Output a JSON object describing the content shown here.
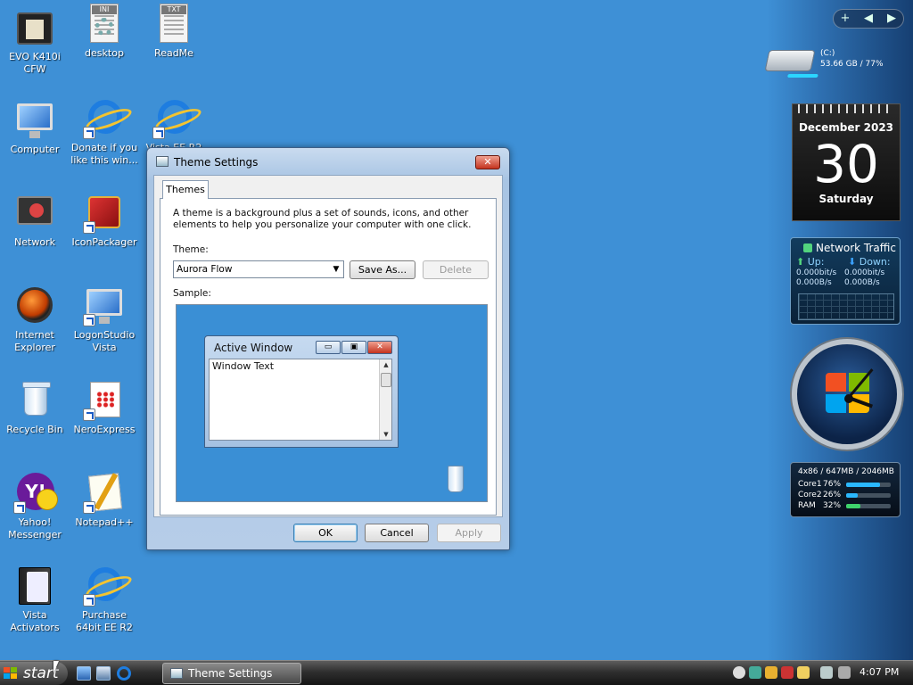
{
  "desktop_icons": [
    {
      "label": "EVO K410i CFW"
    },
    {
      "label": "desktop",
      "tag": "INI"
    },
    {
      "label": "ReadMe",
      "tag": "TXT"
    },
    {
      "label": "Computer"
    },
    {
      "label": "Donate if you like this win..."
    },
    {
      "label": "Vista EE R2"
    },
    {
      "label": "Network"
    },
    {
      "label": "IconPackager"
    },
    {
      "label": "Internet Explorer"
    },
    {
      "label": "LogonStudio Vista"
    },
    {
      "label": "Recycle Bin"
    },
    {
      "label": "NeroExpress"
    },
    {
      "label": "Yahoo! Messenger",
      "glyph_text": "Y!"
    },
    {
      "label": "Notepad++"
    },
    {
      "label": "Vista Activators"
    },
    {
      "label": "Purchase 64bit EE R2"
    }
  ],
  "sidebar": {
    "controls": [
      "+",
      "◀",
      "▶"
    ],
    "drive": {
      "name": "(C:)",
      "usage": "53.66 GB / 77%"
    },
    "calendar": {
      "month": "December 2023",
      "day": "30",
      "weekday": "Saturday"
    },
    "network_traffic": {
      "title": "Network Traffic",
      "up_label": "Up:",
      "down_label": "Down:",
      "up_bits": "0.000bit/s",
      "down_bits": "0.000bit/s",
      "up_bytes": "0.000B/s",
      "down_bytes": "0.000B/s"
    },
    "cpu_meter": {
      "header": "4x86 / 647MB / 2046MB",
      "rows": [
        {
          "name": "Core1",
          "percent": "76%",
          "value": 76,
          "color": "#2ab8ff"
        },
        {
          "name": "Core2",
          "percent": "26%",
          "value": 26,
          "color": "#2ab8ff"
        },
        {
          "name": "RAM",
          "percent": "32%",
          "value": 32,
          "color": "#3ed36b"
        }
      ]
    }
  },
  "dialog": {
    "title": "Theme Settings",
    "close": "✕",
    "tab": "Themes",
    "description": "A theme is a background plus a set of sounds, icons, and other elements to help you personalize your computer with one click.",
    "theme_label": "Theme:",
    "theme_value": "Aurora Flow",
    "save_as": "Save As...",
    "delete": "Delete",
    "sample_label": "Sample:",
    "sample": {
      "window_title": "Active Window",
      "window_text": "Window Text",
      "min": "▭",
      "max": "▣",
      "close": "✕"
    },
    "ok": "OK",
    "cancel": "Cancel",
    "apply": "Apply"
  },
  "taskbar": {
    "start_label": "start",
    "task_button": "Theme Settings",
    "time": "4:07 PM"
  },
  "colors": {
    "desktop": "#3e90d6",
    "flag_red": "#f25022",
    "flag_green": "#7fba00",
    "flag_blue": "#00a4ef",
    "flag_yellow": "#ffb900"
  }
}
